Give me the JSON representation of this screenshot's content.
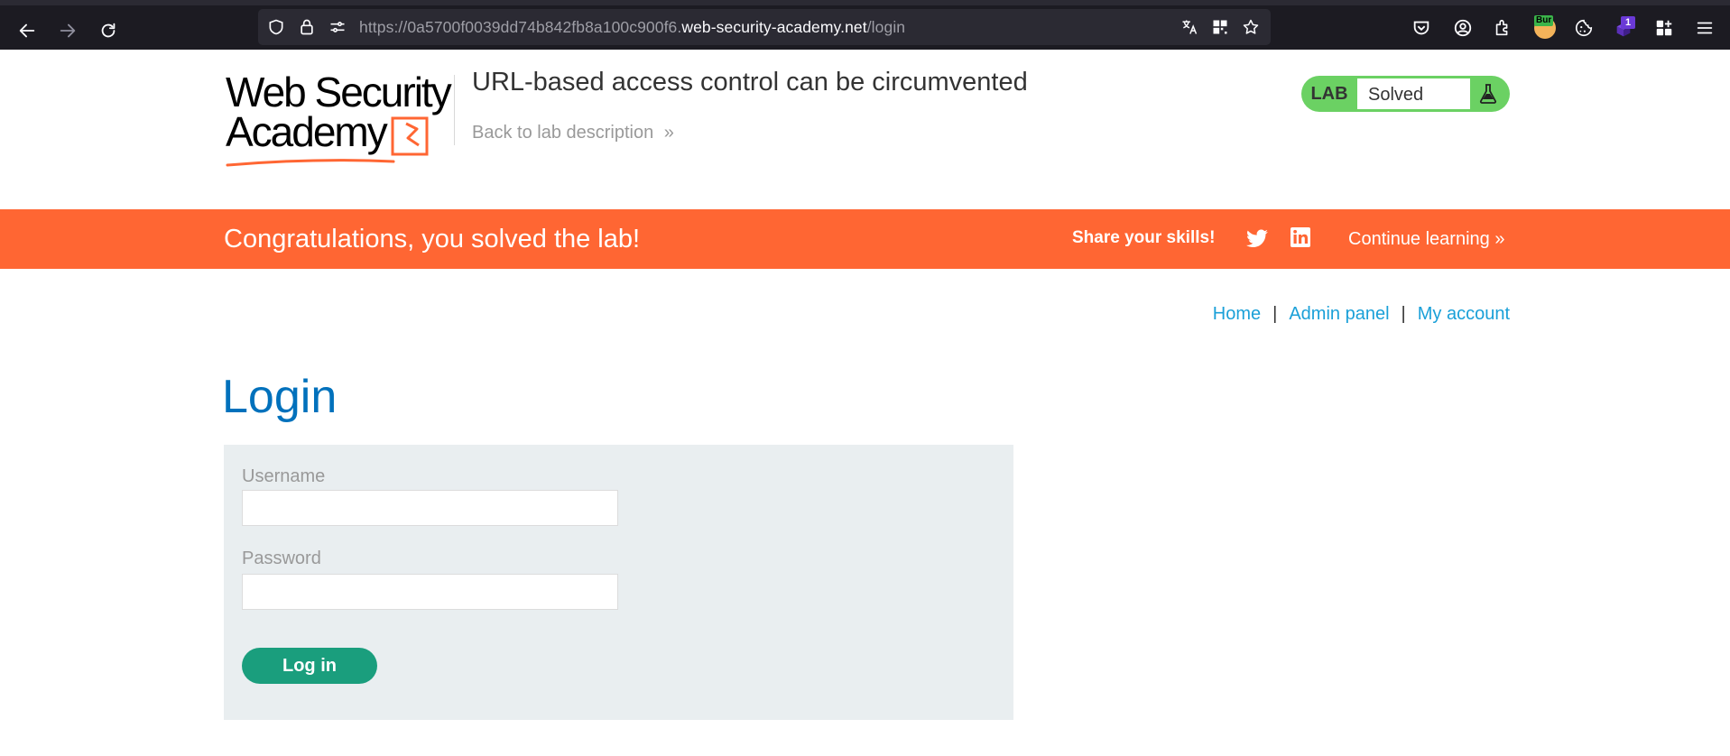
{
  "browser": {
    "url_prefix": "https://0a5700f0039dd74b842fb8a100c900f6.",
    "url_host": "web-security-academy.net",
    "url_path": "/login",
    "extension_bur_label": "Bur",
    "extension_badge_count": "1"
  },
  "header": {
    "logo_line1": "Web Security",
    "logo_line2": "Academy",
    "lab_title": "URL-based access control can be circumvented",
    "back_link": "Back to lab description",
    "lab_tag": "LAB",
    "lab_status": "Solved"
  },
  "banner": {
    "message": "Congratulations, you solved the lab!",
    "share_label": "Share your skills!",
    "continue_label": "Continue learning"
  },
  "nav": {
    "home": "Home",
    "admin_panel": "Admin panel",
    "my_account": "My account",
    "separator": "|"
  },
  "login": {
    "title": "Login",
    "username_label": "Username",
    "username_value": "",
    "password_label": "Password",
    "password_value": "",
    "submit_label": "Log in"
  },
  "colors": {
    "banner": "#ff6633",
    "lab_status_green": "#6bd163",
    "link_blue": "#1aa0d8",
    "title_blue": "#0071bc",
    "button_green": "#1a9e7d",
    "panel_bg": "#e9eef0"
  },
  "icons": [
    "back-arrow-icon",
    "forward-arrow-icon",
    "reload-icon",
    "shield-icon",
    "lock-icon",
    "permissions-icon",
    "translate-icon",
    "qr-code-icon",
    "star-icon",
    "pocket-icon",
    "account-icon",
    "extensions-icon",
    "cookie-icon",
    "grid-icon",
    "menu-icon",
    "flask-icon",
    "twitter-icon",
    "linkedin-icon",
    "chevron-double-right-icon"
  ]
}
